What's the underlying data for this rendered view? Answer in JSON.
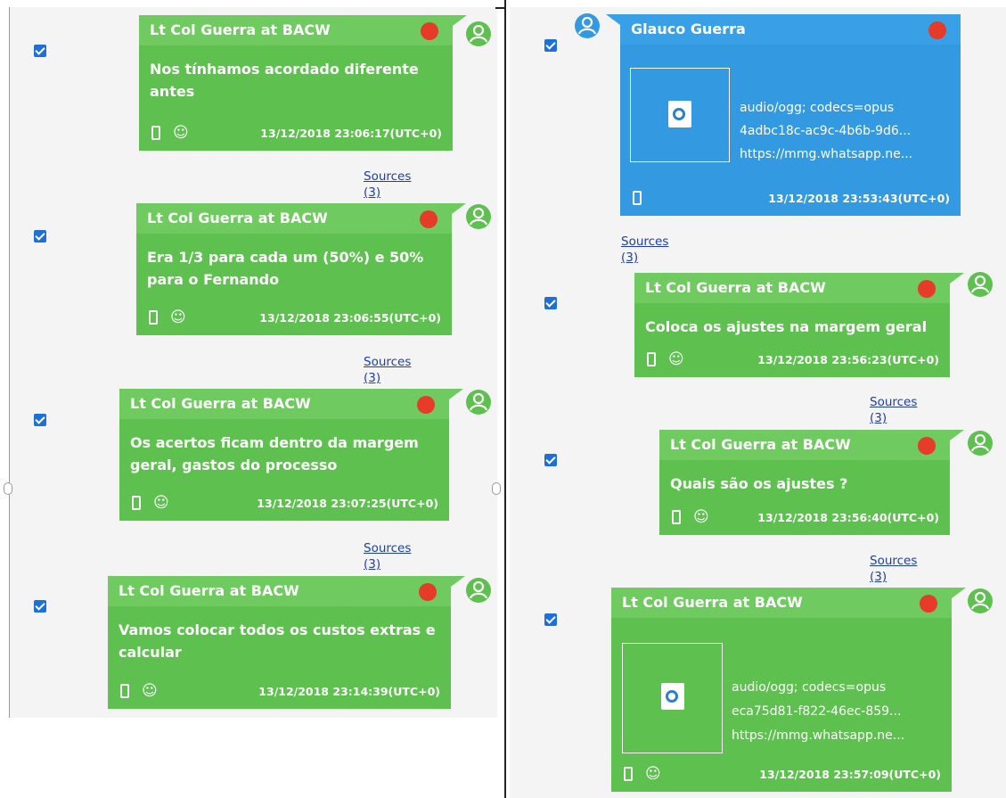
{
  "sources_label": "Sources (3)",
  "left": [
    {
      "sender": "Lt Col Guerra at BACW",
      "text": "Nos tínhamos acordado diferente antes",
      "ts": "13/12/2018 23:06:17(UTC+0)"
    },
    {
      "sender": "Lt Col Guerra at BACW",
      "text": "Era 1/3 para cada um (50%) e 50% para o Fernando",
      "ts": "13/12/2018 23:06:55(UTC+0)"
    },
    {
      "sender": "Lt Col Guerra at BACW",
      "text": "Os acertos ficam dentro da margem geral, gastos do processo",
      "ts": "13/12/2018 23:07:25(UTC+0)"
    },
    {
      "sender": "Lt Col Guerra at BACW",
      "text": "Vamos colocar todos os custos extras e calcular",
      "ts": "13/12/2018 23:14:39(UTC+0)"
    }
  ],
  "right": [
    {
      "sender": "Glauco Guerra",
      "mime": "audio/ogg; codecs=opus",
      "id": "4adbc18c-ac9c-4b6b-9d6...",
      "url": "https://mmg.whatsapp.ne...",
      "ts": "13/12/2018 23:53:43(UTC+0)"
    },
    {
      "sender": "Lt Col Guerra at BACW",
      "text": "Coloca os ajustes na margem geral",
      "ts": "13/12/2018 23:56:23(UTC+0)"
    },
    {
      "sender": "Lt Col Guerra at BACW",
      "text": "Quais são os ajustes ?",
      "ts": "13/12/2018 23:56:40(UTC+0)"
    },
    {
      "sender": "Lt Col Guerra at BACW",
      "mime": "audio/ogg; codecs=opus",
      "id": "eca75d81-f822-46ec-859...",
      "url": "https://mmg.whatsapp.ne...",
      "ts": "13/12/2018 23:57:09(UTC+0)"
    }
  ],
  "colors": {
    "outgoing": "#5ec14f",
    "incoming": "#3399e0",
    "status_dot": "#e53b28",
    "link": "#1f3fa8",
    "checkbox": "#1e6fd9"
  },
  "icons": [
    "checkbox-checked-icon",
    "status-dot-icon",
    "avatar-icon",
    "phone-icon",
    "group-icon",
    "audio-file-icon"
  ]
}
